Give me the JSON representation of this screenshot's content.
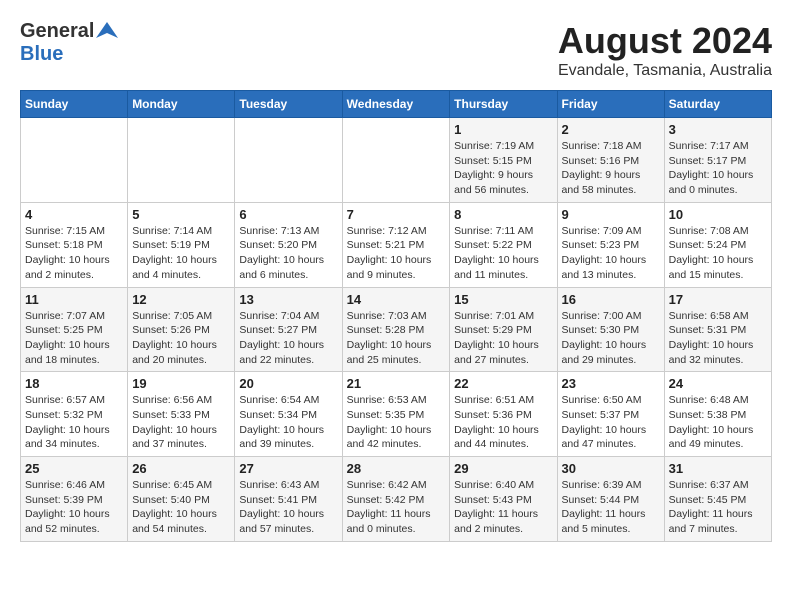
{
  "header": {
    "logo_general": "General",
    "logo_blue": "Blue",
    "title": "August 2024",
    "subtitle": "Evandale, Tasmania, Australia"
  },
  "columns": [
    "Sunday",
    "Monday",
    "Tuesday",
    "Wednesday",
    "Thursday",
    "Friday",
    "Saturday"
  ],
  "weeks": [
    [
      {
        "day": "",
        "info": ""
      },
      {
        "day": "",
        "info": ""
      },
      {
        "day": "",
        "info": ""
      },
      {
        "day": "",
        "info": ""
      },
      {
        "day": "1",
        "info": "Sunrise: 7:19 AM\nSunset: 5:15 PM\nDaylight: 9 hours\nand 56 minutes."
      },
      {
        "day": "2",
        "info": "Sunrise: 7:18 AM\nSunset: 5:16 PM\nDaylight: 9 hours\nand 58 minutes."
      },
      {
        "day": "3",
        "info": "Sunrise: 7:17 AM\nSunset: 5:17 PM\nDaylight: 10 hours\nand 0 minutes."
      }
    ],
    [
      {
        "day": "4",
        "info": "Sunrise: 7:15 AM\nSunset: 5:18 PM\nDaylight: 10 hours\nand 2 minutes."
      },
      {
        "day": "5",
        "info": "Sunrise: 7:14 AM\nSunset: 5:19 PM\nDaylight: 10 hours\nand 4 minutes."
      },
      {
        "day": "6",
        "info": "Sunrise: 7:13 AM\nSunset: 5:20 PM\nDaylight: 10 hours\nand 6 minutes."
      },
      {
        "day": "7",
        "info": "Sunrise: 7:12 AM\nSunset: 5:21 PM\nDaylight: 10 hours\nand 9 minutes."
      },
      {
        "day": "8",
        "info": "Sunrise: 7:11 AM\nSunset: 5:22 PM\nDaylight: 10 hours\nand 11 minutes."
      },
      {
        "day": "9",
        "info": "Sunrise: 7:09 AM\nSunset: 5:23 PM\nDaylight: 10 hours\nand 13 minutes."
      },
      {
        "day": "10",
        "info": "Sunrise: 7:08 AM\nSunset: 5:24 PM\nDaylight: 10 hours\nand 15 minutes."
      }
    ],
    [
      {
        "day": "11",
        "info": "Sunrise: 7:07 AM\nSunset: 5:25 PM\nDaylight: 10 hours\nand 18 minutes."
      },
      {
        "day": "12",
        "info": "Sunrise: 7:05 AM\nSunset: 5:26 PM\nDaylight: 10 hours\nand 20 minutes."
      },
      {
        "day": "13",
        "info": "Sunrise: 7:04 AM\nSunset: 5:27 PM\nDaylight: 10 hours\nand 22 minutes."
      },
      {
        "day": "14",
        "info": "Sunrise: 7:03 AM\nSunset: 5:28 PM\nDaylight: 10 hours\nand 25 minutes."
      },
      {
        "day": "15",
        "info": "Sunrise: 7:01 AM\nSunset: 5:29 PM\nDaylight: 10 hours\nand 27 minutes."
      },
      {
        "day": "16",
        "info": "Sunrise: 7:00 AM\nSunset: 5:30 PM\nDaylight: 10 hours\nand 29 minutes."
      },
      {
        "day": "17",
        "info": "Sunrise: 6:58 AM\nSunset: 5:31 PM\nDaylight: 10 hours\nand 32 minutes."
      }
    ],
    [
      {
        "day": "18",
        "info": "Sunrise: 6:57 AM\nSunset: 5:32 PM\nDaylight: 10 hours\nand 34 minutes."
      },
      {
        "day": "19",
        "info": "Sunrise: 6:56 AM\nSunset: 5:33 PM\nDaylight: 10 hours\nand 37 minutes."
      },
      {
        "day": "20",
        "info": "Sunrise: 6:54 AM\nSunset: 5:34 PM\nDaylight: 10 hours\nand 39 minutes."
      },
      {
        "day": "21",
        "info": "Sunrise: 6:53 AM\nSunset: 5:35 PM\nDaylight: 10 hours\nand 42 minutes."
      },
      {
        "day": "22",
        "info": "Sunrise: 6:51 AM\nSunset: 5:36 PM\nDaylight: 10 hours\nand 44 minutes."
      },
      {
        "day": "23",
        "info": "Sunrise: 6:50 AM\nSunset: 5:37 PM\nDaylight: 10 hours\nand 47 minutes."
      },
      {
        "day": "24",
        "info": "Sunrise: 6:48 AM\nSunset: 5:38 PM\nDaylight: 10 hours\nand 49 minutes."
      }
    ],
    [
      {
        "day": "25",
        "info": "Sunrise: 6:46 AM\nSunset: 5:39 PM\nDaylight: 10 hours\nand 52 minutes."
      },
      {
        "day": "26",
        "info": "Sunrise: 6:45 AM\nSunset: 5:40 PM\nDaylight: 10 hours\nand 54 minutes."
      },
      {
        "day": "27",
        "info": "Sunrise: 6:43 AM\nSunset: 5:41 PM\nDaylight: 10 hours\nand 57 minutes."
      },
      {
        "day": "28",
        "info": "Sunrise: 6:42 AM\nSunset: 5:42 PM\nDaylight: 11 hours\nand 0 minutes."
      },
      {
        "day": "29",
        "info": "Sunrise: 6:40 AM\nSunset: 5:43 PM\nDaylight: 11 hours\nand 2 minutes."
      },
      {
        "day": "30",
        "info": "Sunrise: 6:39 AM\nSunset: 5:44 PM\nDaylight: 11 hours\nand 5 minutes."
      },
      {
        "day": "31",
        "info": "Sunrise: 6:37 AM\nSunset: 5:45 PM\nDaylight: 11 hours\nand 7 minutes."
      }
    ]
  ]
}
